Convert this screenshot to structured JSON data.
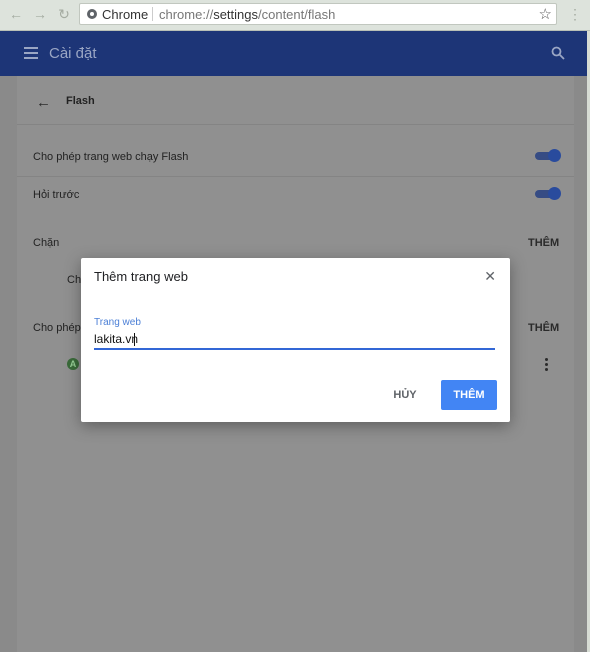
{
  "browser": {
    "site_name": "Chrome",
    "url_scheme": "chrome://",
    "url_host": "settings",
    "url_path": "/content/flash"
  },
  "header": {
    "title": "Cài đặt"
  },
  "page": {
    "section_title": "Flash",
    "allow_flash_label": "Cho phép trang web chạy Flash",
    "ask_first_label": "Hỏi trước",
    "block_heading": "Chặn",
    "block_add": "THÊM",
    "block_truncated": "Ch",
    "allow_heading_truncated": "Cho phép",
    "allow_add": "THÊM",
    "toggle_allow_flash_on": true,
    "toggle_ask_first_on": true
  },
  "dialog": {
    "title": "Thêm trang web",
    "field_label": "Trang web",
    "field_value": "lakita.vn",
    "cancel_label": "HỦY",
    "add_label": "THÊM"
  },
  "colors": {
    "header_bg": "#1d3577",
    "accent": "#4285f4",
    "field_focus": "#3367d6"
  }
}
